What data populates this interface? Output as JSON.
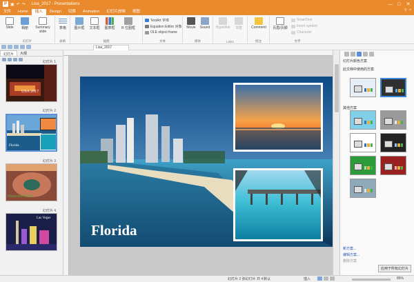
{
  "window": {
    "title": "Lisa_2017 - Presentations",
    "minimize": "—",
    "maximize": "□",
    "close": "✕"
  },
  "menu": {
    "items": [
      "文件",
      "Home",
      "插入",
      "Design",
      "切换",
      "Animation",
      "幻灯片放映",
      "视图"
    ],
    "active_index": 2,
    "right_icons": [
      "?",
      "^"
    ]
  },
  "ribbon": {
    "groups": [
      {
        "label": "幻灯片",
        "buttons": [
          "Slide",
          "相册",
          "Summary slide"
        ]
      },
      {
        "label": "表格",
        "buttons": [
          "表格"
        ]
      },
      {
        "label": "插图",
        "buttons": [
          "图片框",
          "文本框",
          "图表框",
          "B 位图框"
        ]
      },
      {
        "label": "文本",
        "small": [
          "TextArt 字体",
          "Equation Editor 对象",
          "OLE object frame"
        ]
      },
      {
        "label": "媒体",
        "buttons": [
          "Movie",
          "Sound"
        ]
      },
      {
        "label": "Links",
        "buttons": [
          "Hyperlink",
          "书签"
        ]
      },
      {
        "label": "批注",
        "buttons": [
          "Comment"
        ]
      },
      {
        "label": "文字",
        "buttons": [
          "页眉/页脚"
        ],
        "small": [
          "SmartText",
          "Insert symbol",
          "Character"
        ]
      }
    ]
  },
  "doc_tab": {
    "name": "Lisa_2017"
  },
  "left_panel": {
    "tabs": [
      "幻灯片",
      "大纲"
    ],
    "slides": [
      {
        "label": "幻灯片 1",
        "caption": "USA 2017"
      },
      {
        "label": "幻灯片 2",
        "caption": "Florida"
      },
      {
        "label": "幻灯片 3",
        "caption": "Horseshoe Bend"
      },
      {
        "label": "幻灯片 4",
        "caption": "Las Vegas"
      }
    ]
  },
  "slide": {
    "title": "Florida"
  },
  "right_panel": {
    "title": "幻灯片颜色方案",
    "section1": "此文档中使用的方案",
    "section2": "其他方案",
    "links": [
      "新方案...",
      "编辑方案...",
      "删除方案"
    ],
    "apply_button": "应用于所有幻灯片",
    "swatches": [
      {
        "bg": "#e8eef6",
        "accent": "#3a6fb5"
      },
      {
        "bg": "#303030",
        "accent": "#58a8e8"
      },
      {
        "bg": "#7fd0e8",
        "accent": "#2b7db8"
      },
      {
        "bg": "#9a9a9a",
        "accent": "#e8e8e8"
      },
      {
        "bg": "#ffffff",
        "accent": "#3a6fb5"
      },
      {
        "bg": "#222222",
        "accent": "#8fc1ff"
      },
      {
        "bg": "#2e9b3a",
        "accent": "#a8e0a0"
      },
      {
        "bg": "#9b2020",
        "accent": "#f2b0b0"
      },
      {
        "bg": "#8fa9b8",
        "accent": "#d8e4ea"
      }
    ]
  },
  "status": {
    "slide_info": "幻灯片 2 张幻灯片 共 4",
    "language": "默认",
    "mode": "插入",
    "zoom": "86%"
  }
}
